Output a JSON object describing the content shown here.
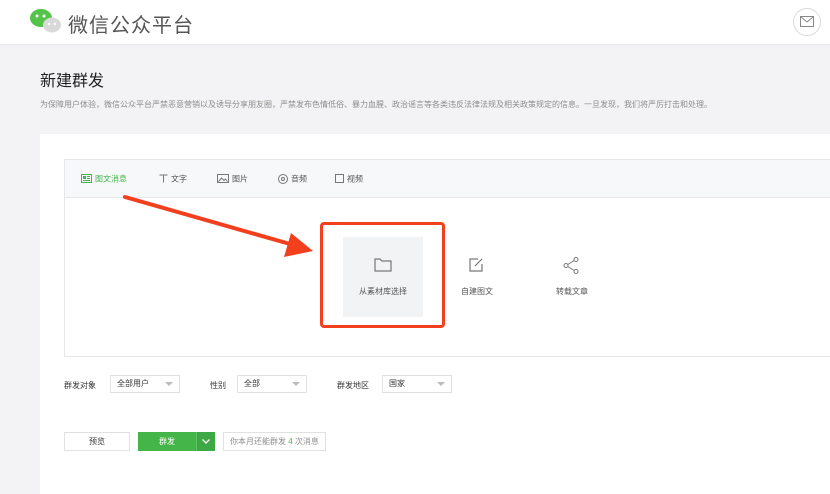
{
  "header": {
    "brand": "微信公众平台",
    "logo_icon": "wechat-logo-icon",
    "mail_icon": "mail-icon"
  },
  "page": {
    "title": "新建群发",
    "notice": "为保障用户体验，微信公众平台严禁恶意营销以及诱导分享朋友圈，严禁发布色情低俗、暴力血腥、政治谣言等各类违反法律法规及相关政策规定的信息。一旦发现，我们将严厉打击和处理。"
  },
  "tabs": [
    {
      "label": "图文消息",
      "icon": "article-icon",
      "active": true
    },
    {
      "label": "文字",
      "icon": "text-icon",
      "active": false
    },
    {
      "label": "图片",
      "icon": "image-icon",
      "active": false
    },
    {
      "label": "音频",
      "icon": "audio-icon",
      "active": false
    },
    {
      "label": "视频",
      "icon": "video-icon",
      "active": false
    }
  ],
  "choices": [
    {
      "label": "从素材库选择",
      "icon": "folder-icon"
    },
    {
      "label": "自建图文",
      "icon": "edit-icon"
    },
    {
      "label": "转载文章",
      "icon": "share-icon"
    }
  ],
  "filters": {
    "audience_label": "群发对象",
    "audience_value": "全部用户",
    "gender_label": "性别",
    "gender_value": "全部",
    "region_label": "群发地区",
    "region_value": "国家"
  },
  "actions": {
    "preview": "预览",
    "send": "群发",
    "quota_prefix": "你本月还能群发",
    "quota_count": "4",
    "quota_suffix": "次消息"
  },
  "colors": {
    "accent_green": "#44b549",
    "annotation_red": "#f2401f"
  }
}
